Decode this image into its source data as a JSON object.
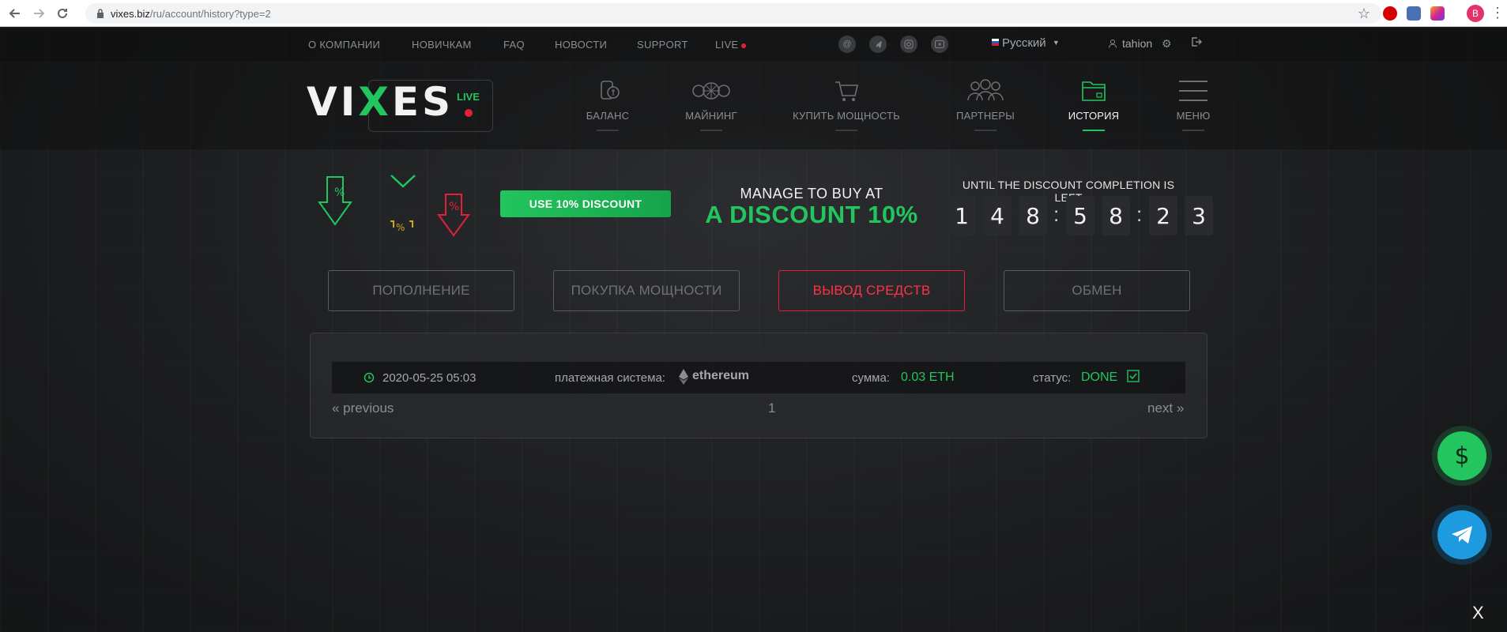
{
  "browser": {
    "url_host": "vixes.biz",
    "url_path": "/ru/account/history?type=2",
    "profile_initial": "B"
  },
  "topbar": {
    "links": [
      "О КОМПАНИИ",
      "НОВИЧКАМ",
      "FAQ",
      "НОВОСТИ",
      "SUPPORT",
      "LIVE"
    ],
    "language": "Русский",
    "username": "tahion"
  },
  "logo": {
    "text_pre": "VI",
    "text_x": "X",
    "text_post": "ES",
    "live_label": "LIVE"
  },
  "mainnav": {
    "items": [
      {
        "label": "БАЛАНС",
        "icon": "coins-icon"
      },
      {
        "label": "МАЙНИНГ",
        "icon": "fans-icon"
      },
      {
        "label": "КУПИТЬ МОЩНОСТЬ",
        "icon": "cart-icon"
      },
      {
        "label": "ПАРТНЕРЫ",
        "icon": "people-icon"
      },
      {
        "label": "ИСТОРИЯ",
        "icon": "folder-icon",
        "active": true
      },
      {
        "label": "МЕНЮ",
        "icon": "hamburger-icon"
      }
    ]
  },
  "promo": {
    "button": "USE 10% DISCOUNT",
    "line1": "MANAGE TO BUY AT",
    "line2": "A DISCOUNT 10%",
    "countdown_title": "UNTIL THE DISCOUNT COMPLETION IS LEFT",
    "digits": [
      "1",
      "4",
      "8",
      "5",
      "8",
      "2",
      "3"
    ],
    "separator": ":"
  },
  "tabs": [
    {
      "label": "ПОПОЛНЕНИЕ"
    },
    {
      "label": "ПОКУПКА МОЩНОСТИ"
    },
    {
      "label": "ВЫВОД СРЕДСТВ",
      "active": true
    },
    {
      "label": "ОБМЕН"
    }
  ],
  "history": {
    "rows": [
      {
        "date": "2020-05-25 05:03",
        "payment_label": "платежная система:",
        "payment_system": "ethereum",
        "amount_label": "сумма:",
        "amount": "0.03 ETH",
        "status_label": "статус:",
        "status": "DONE"
      }
    ],
    "pager": {
      "previous": "« previous",
      "page": "1",
      "next": "next »"
    }
  },
  "floating": {
    "close": "X"
  },
  "colors": {
    "accent": "#22c55e",
    "danger": "#e0213a",
    "telegram": "#1e9be0"
  }
}
